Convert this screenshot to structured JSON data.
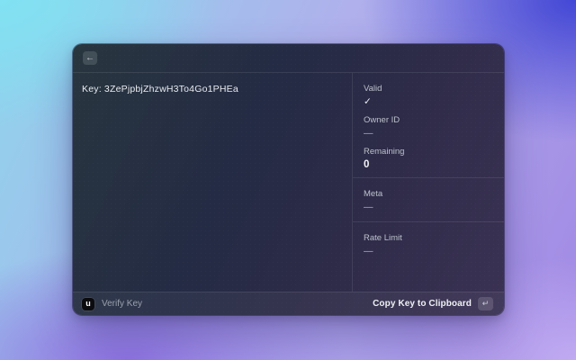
{
  "window": {
    "header": {
      "back_icon": "←"
    },
    "key_display": {
      "text": "Key: 3ZePjpbjZhzwH3To4Go1PHEa"
    },
    "details": {
      "sections": [
        {
          "fields": [
            {
              "label": "Valid",
              "value": "✓"
            },
            {
              "label": "Owner ID",
              "value": "—"
            },
            {
              "label": "Remaining",
              "value": "0"
            }
          ]
        },
        {
          "fields": [
            {
              "label": "Meta",
              "value": "—"
            }
          ]
        },
        {
          "fields": [
            {
              "label": "Rate Limit",
              "value": "—"
            }
          ]
        }
      ]
    },
    "footer": {
      "app_badge_glyph": "u",
      "command_name": "Verify Key",
      "primary_action_label": "Copy Key to Clipboard",
      "enter_key_glyph": "↵"
    }
  },
  "colors": {
    "window_bg_start": "#28363f",
    "window_bg_end": "#3b3253",
    "bg_top_left": "#80e2f2",
    "bg_top_right": "#4247d5",
    "bg_bottom_right": "#c0abf2",
    "bg_bottom_left": "#8d72e0",
    "text_primary": "#edeef3",
    "text_label": "#bdc1cb",
    "text_muted": "#9aa0ac"
  }
}
